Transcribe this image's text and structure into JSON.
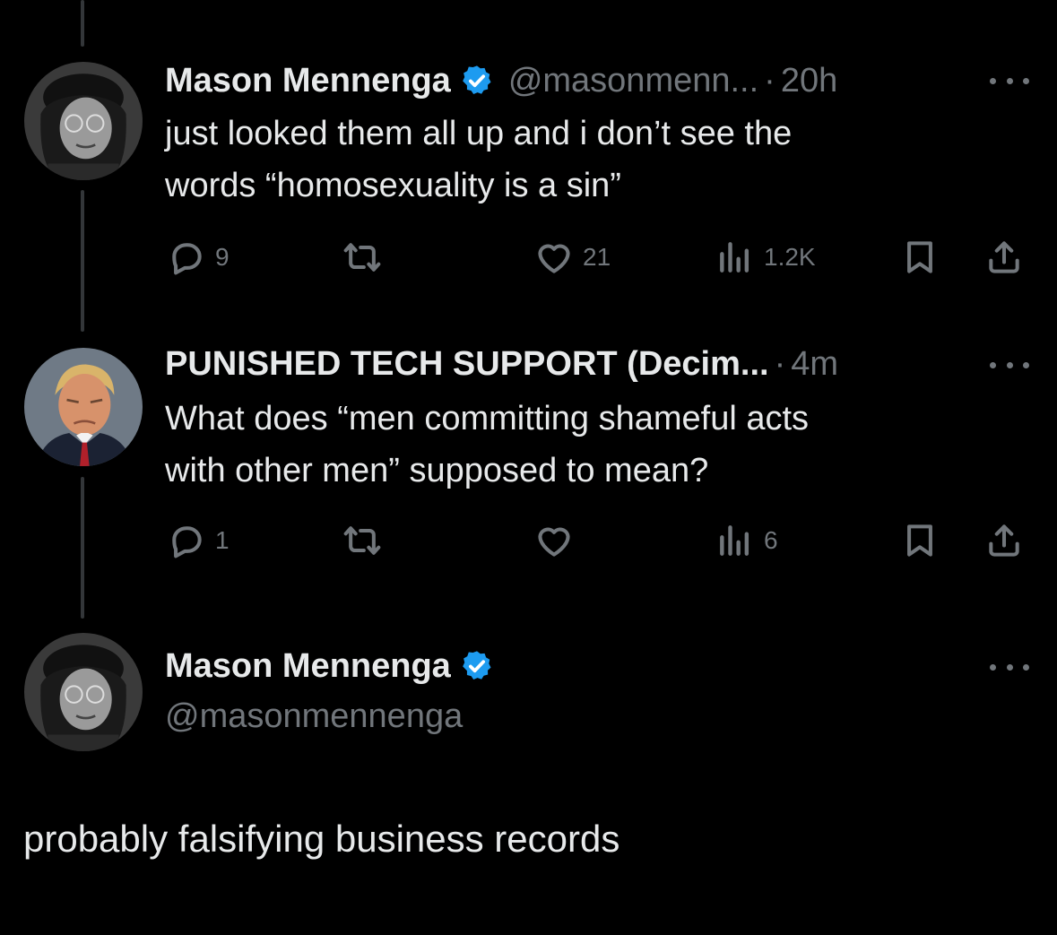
{
  "tweets": [
    {
      "author": "Mason Mennenga",
      "verified": true,
      "handle": "@masonmenn...",
      "separator": "·",
      "time": "20h",
      "text_lines": [
        "just looked them all up and i don’t see the",
        "words “homosexuality is a sin”"
      ],
      "replies": "9",
      "retweets": "",
      "likes": "21",
      "views": "1.2K"
    },
    {
      "author": "PUNISHED TECH SUPPORT (Decim...",
      "verified": false,
      "separator": "·",
      "time": "4m",
      "text_lines": [
        "What does “men committing shameful acts",
        "with other men” supposed to mean?"
      ],
      "replies": "1",
      "retweets": "",
      "likes": "",
      "views": "6"
    },
    {
      "author": "Mason Mennenga",
      "verified": true,
      "handle": "@masonmennenga",
      "text": "probably falsifying business records"
    }
  ],
  "colors": {
    "background": "#000000",
    "text_primary": "#e7e9ea",
    "text_secondary": "#71767b",
    "verified_blue": "#1d9bf0",
    "thread_line": "#333639"
  },
  "icons": [
    "reply-icon",
    "retweet-icon",
    "like-icon",
    "views-icon",
    "bookmark-icon",
    "share-icon",
    "more-icon",
    "verified-badge-icon"
  ]
}
